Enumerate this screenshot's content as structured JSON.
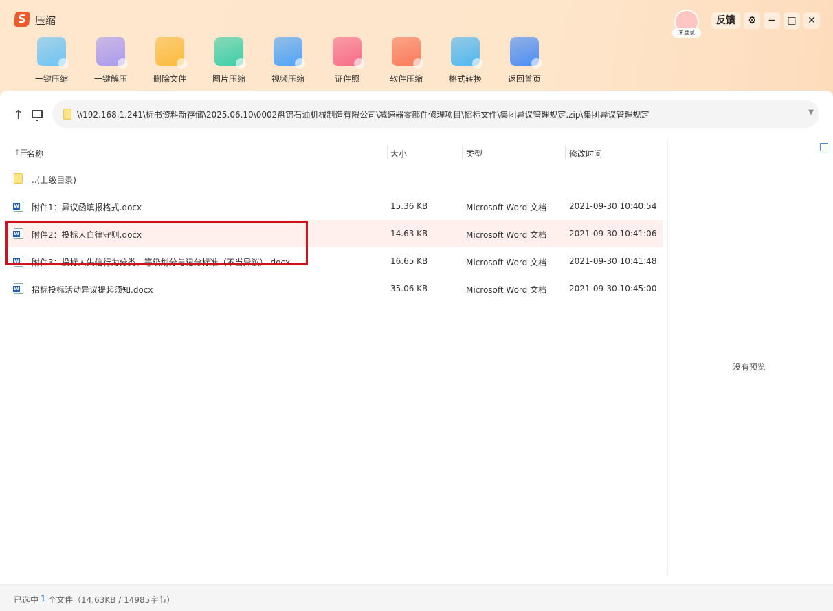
{
  "app": {
    "title": "压缩",
    "logo": "S"
  },
  "toolbar": [
    {
      "label": "一键压缩",
      "icon": "folder-compress-icon",
      "color": "#6cc4f5"
    },
    {
      "label": "一键解压",
      "icon": "zip-extract-icon",
      "color": "#a99af0"
    },
    {
      "label": "删除文件",
      "icon": "trash-icon",
      "color": "#fbbb3d"
    },
    {
      "label": "图片压缩",
      "icon": "image-compress-icon",
      "color": "#3ccfa8"
    },
    {
      "label": "视频压缩",
      "icon": "video-compress-icon",
      "color": "#4ea3f7"
    },
    {
      "label": "证件照",
      "icon": "id-photo-icon",
      "color": "#f76b8a"
    },
    {
      "label": "软件压缩",
      "icon": "software-compress-icon",
      "color": "#f97a5a"
    },
    {
      "label": "格式转换",
      "icon": "format-convert-icon",
      "color": "#4fb7f2"
    },
    {
      "label": "返回首页",
      "icon": "home-icon",
      "color": "#4c8df5"
    }
  ],
  "window": {
    "user": "未登录",
    "feedback": "反馈",
    "settings": "⚙",
    "minimize": "−",
    "maximize": "□",
    "close": "✕"
  },
  "path": "\\\\192.168.1.241\\标书资料新存储\\2025.06.10\\0002盘锦石油机械制造有限公司\\减速器零部件修理项目\\招标文件\\集团异议管理规定.zip\\集团异议管理规定",
  "columns": {
    "name": "名称",
    "size": "大小",
    "type": "类型",
    "modified": "修改时间"
  },
  "parent_dir": "..(上级目录)",
  "files": [
    {
      "name": "附件1：异议函填报格式.docx",
      "size": "15.36 KB",
      "type": "Microsoft Word 文档",
      "modified": "2021-09-30 10:40:54",
      "selected": false
    },
    {
      "name": "附件2：投标人自律守则.docx",
      "size": "14.63 KB",
      "type": "Microsoft Word 文档",
      "modified": "2021-09-30 10:41:06",
      "selected": true
    },
    {
      "name": "附件3：投标人失信行为分类、等级划分与记分标准（不当异议）.docx",
      "size": "16.65 KB",
      "type": "Microsoft Word 文档",
      "modified": "2021-09-30 10:41:48",
      "selected": false
    },
    {
      "name": "招标投标活动异议提起须知.docx",
      "size": "35.06 KB",
      "type": "Microsoft Word 文档",
      "modified": "2021-09-30 10:45:00",
      "selected": false
    }
  ],
  "preview": "没有预览",
  "status": {
    "prefix": "已选中",
    "count": "1",
    "suffix": "个文件（14.63KB / 14985字节）"
  },
  "accent": "#2f7fe0"
}
